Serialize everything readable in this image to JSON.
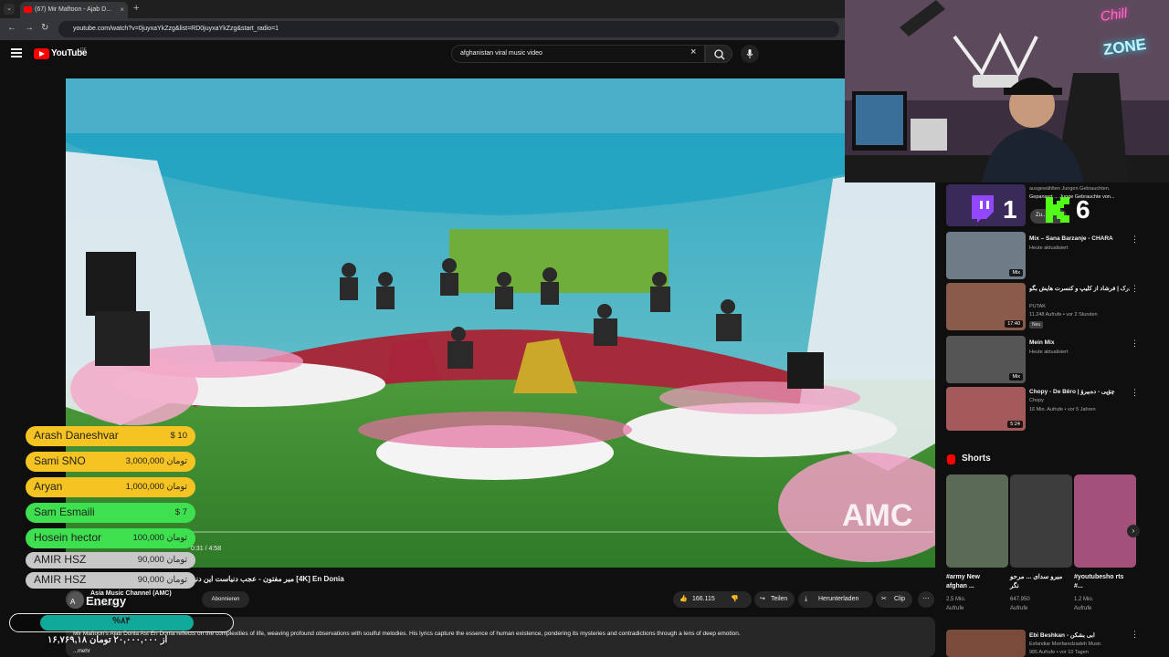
{
  "browser": {
    "tab_title": "(67) Mir Maftoon - Ajab D...",
    "new_tab": "+",
    "url": "youtube.com/watch?v=0juyxaYkZzg&list=RD0juyxaYkZzg&start_radio=1"
  },
  "youtube": {
    "logo_text": "YouTube",
    "country": "DE",
    "search_value": "afghanistan viral music video"
  },
  "video": {
    "time": "0:31 / 4:58",
    "progress": 0.104,
    "title": "میر مفتون - عجب دنیاست این دنیا [4K] En Donia",
    "channel_name": "Asia Music Channel (AMC)",
    "subscribers": "Abonnenten",
    "subscribe_label": "Abonnieren",
    "likes": "166.115",
    "share_label": "Teilen",
    "download_label": "Herunterladen",
    "clip_label": "Clip",
    "description": "Mir Maftoon's Ajab Donia Ast En Donia reflects on the complexities of life, weaving profound observations with soulful melodies. His lyrics capture the essence of human existence, pondering its mysteries and contradictions through a lens of deep emotion.",
    "more_label": "...mehr"
  },
  "sidebar": {
    "ad": {
      "line1": "ausgewählten Jungen Gebrauchten.",
      "line2": "Gepansert ... Junge Gebrauchte von...",
      "button": "Zu..."
    },
    "items": [
      {
        "title": "Mix – Sana Barzanje - CHARA",
        "meta1": "Heute aktualisiert",
        "meta2": "",
        "badge": "Mix",
        "thumb_color": "#6d7c87"
      },
      {
        "title": "سوالات سمی از فرشاد سایلنت با پدرک | فرشاد از کلیپ و کنسرت هایش بگو",
        "meta1": "PUTAK",
        "meta2": "11.248 Aufrufe • vor 2 Stunden",
        "badge": "17:40",
        "extra": "Neu",
        "thumb_color": "#8a5a4a"
      },
      {
        "title": "Mein Mix",
        "meta1": "Heute aktualisiert",
        "meta2": "",
        "badge": "Mix",
        "thumb_color": "#555"
      },
      {
        "title": "Chopy - De Bêro | چۆپی - دەبیرۆ",
        "meta1": "Chopy",
        "meta2": "16 Mio. Aufrufe • vor 5 Jahren",
        "badge": "5:24",
        "thumb_color": "#a45a5a"
      },
      {
        "title": "Ebi Beshkan - ابی بشکن",
        "meta1": "Esfandiar Monfaredzadeh Music",
        "meta2": "985 Aufrufe • vor 10 Tagen",
        "badge": "",
        "thumb_color": "#7a4a3a"
      }
    ],
    "shorts_heading": "Shorts",
    "shorts": [
      {
        "title": "#army New afghan ...",
        "meta1": "2,5 Mio.",
        "meta2": "Aufrufe",
        "color": "#5b6a55"
      },
      {
        "title": "میرو سدای ... مرحو نگر",
        "meta1": "647.950",
        "meta2": "Aufrufe",
        "color": "#3d3d3d"
      },
      {
        "title": "#youtubesho rts #...",
        "meta1": "1,2 Mio.",
        "meta2": "Aufrufe",
        "color": "#a3507a"
      }
    ]
  },
  "webcam": {
    "neon1": "Chill",
    "neon2": "ZONE"
  },
  "overlay": {
    "counter_left": "1",
    "counter_right": "6",
    "donations": [
      {
        "name": "Arash Daneshvar",
        "amount": "$ 10",
        "color": "#f5c423"
      },
      {
        "name": "Sami SNO",
        "amount": "3,000,000 تومان",
        "color": "#f5c423"
      },
      {
        "name": "Aryan",
        "amount": "1,000,000 تومان",
        "color": "#f5c423"
      },
      {
        "name": "Sam Esmaili",
        "amount": "$ 7",
        "color": "#3ee04f"
      },
      {
        "name": "Hosein hector",
        "amount": "100,000 تومان",
        "color": "#3ee04f"
      },
      {
        "name": "AMIR HSZ",
        "amount": "90,000 تومان",
        "color": "#c8c8c8"
      },
      {
        "name": "AMIR HSZ",
        "amount": "90,000 تومان",
        "color": "#c8c8c8"
      }
    ],
    "energy_label": "Energy",
    "energy_percent_text": "%۸۴",
    "energy_fraction": 0.84,
    "goal_text": "۱۶,۷۶۹,۱۸ از ۲۰,۰۰۰,۰۰۰ تومان"
  }
}
